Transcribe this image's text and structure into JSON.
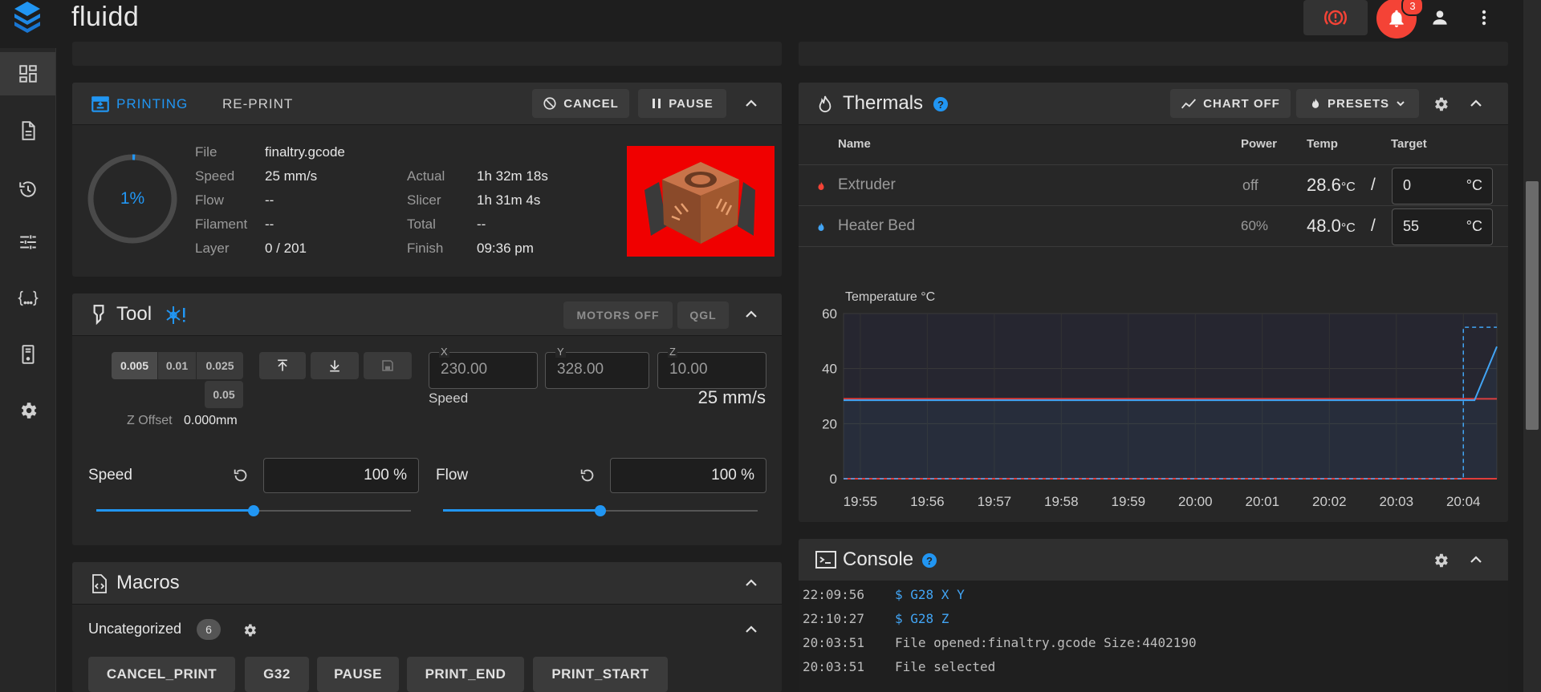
{
  "app": {
    "title": "fluidd",
    "notification_count": "3"
  },
  "sidebar": {
    "items": [
      {
        "icon": "dashboard-icon"
      },
      {
        "icon": "file-icon"
      },
      {
        "icon": "history-icon"
      },
      {
        "icon": "tune-icon"
      },
      {
        "icon": "code-braces-icon"
      },
      {
        "icon": "printer-device-icon"
      },
      {
        "icon": "gear-icon"
      }
    ]
  },
  "printing": {
    "tab_active": "PRINTING",
    "tab_reprint": "RE-PRINT",
    "cancel_label": "CANCEL",
    "pause_label": "PAUSE",
    "progress_text": "1%",
    "progress": 0.01,
    "file_label": "File",
    "file_value": "finaltry.gcode",
    "speed_label": "Speed",
    "speed_value": "25 mm/s",
    "flow_label": "Flow",
    "flow_value": "--",
    "filament_label": "Filament",
    "filament_value": "--",
    "layer_label": "Layer",
    "layer_value": "0 / 201",
    "actual_label": "Actual",
    "actual_value": "1h 32m 18s",
    "slicer_label": "Slicer",
    "slicer_value": "1h 31m 4s",
    "total_label": "Total",
    "total_value": "--",
    "finish_label": "Finish",
    "finish_value": "09:36 pm"
  },
  "tool": {
    "title": "Tool",
    "motors_off_label": "MOTORS OFF",
    "qgl_label": "QGL",
    "step_values": [
      "0.005",
      "0.01",
      "0.025",
      "0.05"
    ],
    "z_offset_label": "Z Offset",
    "z_offset_value": "0.000mm",
    "x_label": "X",
    "x_value": "230.00",
    "y_label": "Y",
    "y_value": "328.00",
    "z_label": "Z",
    "z_value": "10.00",
    "speed_caption": "Speed",
    "speed_readout": "25 mm/s",
    "speed_factor_label": "Speed",
    "speed_factor_value": "100 %",
    "flow_factor_label": "Flow",
    "flow_factor_value": "100 %",
    "speed_slider": 0.5,
    "flow_slider": 0.5
  },
  "macros": {
    "title": "Macros",
    "category": "Uncategorized",
    "category_count": "6",
    "buttons": [
      "CANCEL_PRINT",
      "G32",
      "PAUSE",
      "PRINT_END",
      "PRINT_START"
    ]
  },
  "thermals": {
    "title": "Thermals",
    "chart_off_label": "CHART OFF",
    "presets_label": "PRESETS",
    "columns": [
      "Name",
      "Power",
      "Temp",
      "Target"
    ],
    "rows": [
      {
        "name": "Extruder",
        "power": "off",
        "temp": "28.6",
        "temp_unit": "°C",
        "slash": "/",
        "target": "0",
        "target_unit": "°C",
        "icon": "fire-icon"
      },
      {
        "name": "Heater Bed",
        "power": "60%",
        "temp": "48.0",
        "temp_unit": "°C",
        "slash": "/",
        "target": "55",
        "target_unit": "°C",
        "icon": "fire-icon"
      }
    ]
  },
  "chart_data": {
    "type": "line",
    "title": "",
    "ylabel": "Temperature °C",
    "xlabel": "",
    "x_ticks": [
      "19:55",
      "19:56",
      "19:57",
      "19:58",
      "19:59",
      "20:00",
      "20:01",
      "20:02",
      "20:03",
      "20:04"
    ],
    "y_ticks": [
      "0",
      "20",
      "40",
      "60"
    ],
    "ylim": [
      0,
      60
    ],
    "grid": true,
    "series": [
      {
        "color": "#e53935",
        "x": [
          "19:54:45",
          "20:04:10",
          "20:04:30"
        ],
        "y": [
          29,
          29,
          29
        ]
      },
      {
        "color": "#42a5f5",
        "x": [
          "19:54:45",
          "20:04:10",
          "20:04:30"
        ],
        "y": [
          28.5,
          28.5,
          48
        ]
      },
      {
        "color": "#e53935",
        "x": [
          "19:54:45",
          "20:04:30"
        ],
        "y": [
          0,
          0
        ]
      },
      {
        "color": "#42a5f5",
        "x": [
          "19:54:45",
          "20:04:00",
          "20:04:00",
          "20:04:30"
        ],
        "y": [
          0,
          0,
          55,
          55
        ],
        "dashed": true
      }
    ]
  },
  "console": {
    "title": "Console",
    "lines": [
      {
        "time": "22:09:56",
        "text": "$ G28 X Y",
        "type": "command"
      },
      {
        "time": "22:10:27",
        "text": "$ G28 Z",
        "type": "command"
      },
      {
        "time": "20:03:51",
        "text": "File opened:finaltry.gcode Size:4402190",
        "type": "response"
      },
      {
        "time": "20:03:51",
        "text": "File selected",
        "type": "response"
      }
    ]
  },
  "colors": {
    "accent": "#2196f3",
    "danger": "#f44336",
    "card": "#272727",
    "background": "#1e1e1e"
  }
}
